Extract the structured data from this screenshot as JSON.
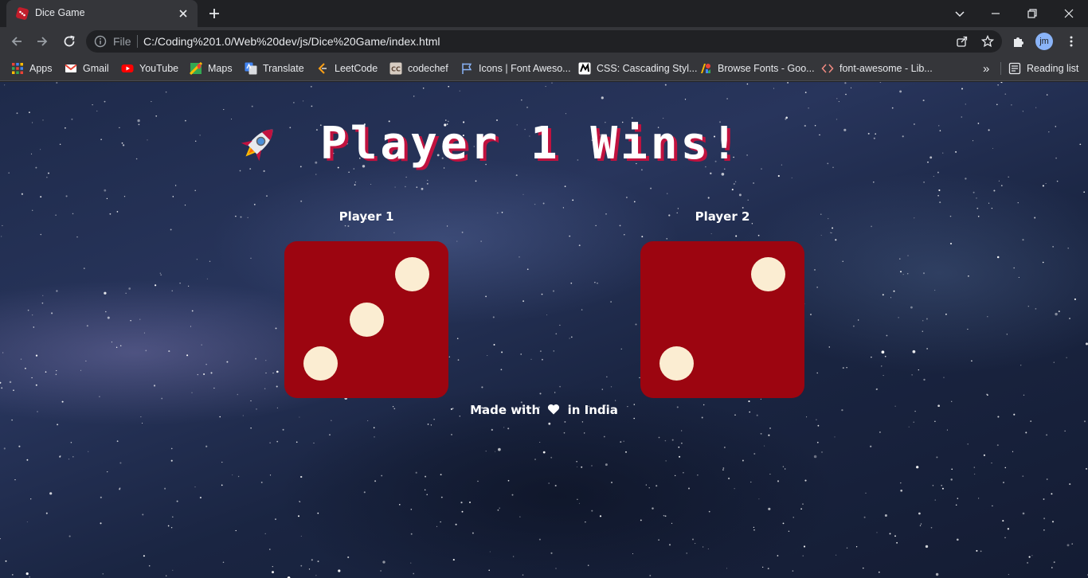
{
  "browser": {
    "tab_title": "Dice Game",
    "file_label": "File",
    "url": "C:/Coding%201.0/Web%20dev/js/Dice%20Game/index.html",
    "avatar_initials": "jm",
    "reading_list": "Reading list",
    "more_bookmarks": "»",
    "bookmarks": [
      {
        "label": "Apps",
        "icon": "apps-grid-icon"
      },
      {
        "label": "Gmail",
        "icon": "gmail-icon"
      },
      {
        "label": "YouTube",
        "icon": "youtube-icon"
      },
      {
        "label": "Maps",
        "icon": "maps-icon"
      },
      {
        "label": "Translate",
        "icon": "translate-icon"
      },
      {
        "label": "LeetCode",
        "icon": "leetcode-icon"
      },
      {
        "label": "codechef",
        "icon": "codechef-icon"
      },
      {
        "label": "Icons | Font Aweso...",
        "icon": "flag-icon"
      },
      {
        "label": "CSS: Cascading Styl...",
        "icon": "mdn-icon"
      },
      {
        "label": "Browse Fonts - Goo...",
        "icon": "google-fonts-icon"
      },
      {
        "label": "font-awesome - Lib...",
        "icon": "code-icon"
      }
    ]
  },
  "game": {
    "headline": "Player 1 Wins!",
    "headline_icon": "rocket-icon",
    "players": [
      {
        "label": "Player 1",
        "die_value": 3
      },
      {
        "label": "Player 2",
        "die_value": 2
      }
    ],
    "footer": {
      "before": "Made with",
      "icon": "heart-icon",
      "after": "in India"
    }
  },
  "colors": {
    "die": "#9c0510",
    "pip": "#fbedd2",
    "headline_shadow": "#c1123f",
    "text": "#ffffff"
  }
}
